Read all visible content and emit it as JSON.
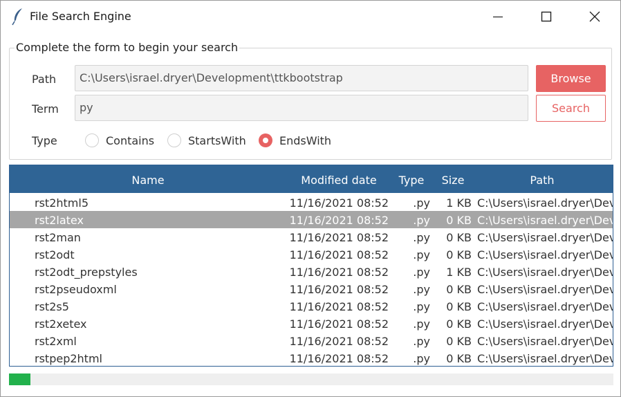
{
  "window": {
    "title": "File Search Engine",
    "icon": "feather-icon"
  },
  "form": {
    "legend": "Complete the form to begin your search",
    "path_label": "Path",
    "path_value": "C:\\Users\\israel.dryer\\Development\\ttkbootstrap",
    "term_label": "Term",
    "term_value": "py",
    "type_label": "Type",
    "browse_label": "Browse",
    "search_label": "Search",
    "search_types": [
      {
        "label": "Contains",
        "selected": false
      },
      {
        "label": "StartsWith",
        "selected": false
      },
      {
        "label": "EndsWith",
        "selected": true
      }
    ]
  },
  "results": {
    "columns": [
      "Name",
      "Modified date",
      "Type",
      "Size",
      "Path"
    ],
    "selected_index": 1,
    "rows": [
      {
        "name": "rst2html5",
        "date": "11/16/2021 08:52",
        "type": ".py",
        "size": "1 KB",
        "path": "C:\\Users\\israel.dryer\\Dev"
      },
      {
        "name": "rst2latex",
        "date": "11/16/2021 08:52",
        "type": ".py",
        "size": "0 KB",
        "path": "C:\\Users\\israel.dryer\\Dev"
      },
      {
        "name": "rst2man",
        "date": "11/16/2021 08:52",
        "type": ".py",
        "size": "0 KB",
        "path": "C:\\Users\\israel.dryer\\Dev"
      },
      {
        "name": "rst2odt",
        "date": "11/16/2021 08:52",
        "type": ".py",
        "size": "0 KB",
        "path": "C:\\Users\\israel.dryer\\Dev"
      },
      {
        "name": "rst2odt_prepstyles",
        "date": "11/16/2021 08:52",
        "type": ".py",
        "size": "1 KB",
        "path": "C:\\Users\\israel.dryer\\Dev"
      },
      {
        "name": "rst2pseudoxml",
        "date": "11/16/2021 08:52",
        "type": ".py",
        "size": "0 KB",
        "path": "C:\\Users\\israel.dryer\\Dev"
      },
      {
        "name": "rst2s5",
        "date": "11/16/2021 08:52",
        "type": ".py",
        "size": "0 KB",
        "path": "C:\\Users\\israel.dryer\\Dev"
      },
      {
        "name": "rst2xetex",
        "date": "11/16/2021 08:52",
        "type": ".py",
        "size": "0 KB",
        "path": "C:\\Users\\israel.dryer\\Dev"
      },
      {
        "name": "rst2xml",
        "date": "11/16/2021 08:52",
        "type": ".py",
        "size": "0 KB",
        "path": "C:\\Users\\israel.dryer\\Dev"
      },
      {
        "name": "rstpep2html",
        "date": "11/16/2021 08:52",
        "type": ".py",
        "size": "0 KB",
        "path": "C:\\Users\\israel.dryer\\Dev"
      }
    ]
  },
  "progress": {
    "fraction": 0.036,
    "color": "#22b14c"
  },
  "colors": {
    "accent": "#e76363",
    "header": "#2f6495",
    "selected_row": "#a6a6a6"
  }
}
